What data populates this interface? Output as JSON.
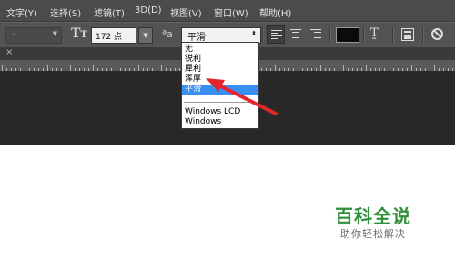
{
  "menu": {
    "items": [
      "文字(Y)",
      "选择(S)",
      "滤镜(T)",
      "3D(D)",
      "视图(V)",
      "窗口(W)",
      "帮助(H)"
    ]
  },
  "options_bar": {
    "font_style_value": "-",
    "font_size_value": "172 点",
    "anti_alias_icon_text": "ªa",
    "anti_alias_value": "平滑",
    "text_color": "#0b0b0b"
  },
  "antialias_dropdown": {
    "options": [
      "无",
      "锐利",
      "犀利",
      "浑厚",
      "平滑"
    ],
    "selected": "平滑",
    "extra_options": [
      "Windows LCD",
      "Windows"
    ]
  },
  "document_tab": {
    "close_glyph": "×"
  },
  "annotation": {
    "arrow_color": "#e4262c"
  },
  "watermark": {
    "title": "百科全说",
    "subtitle": "助你轻松解决"
  }
}
